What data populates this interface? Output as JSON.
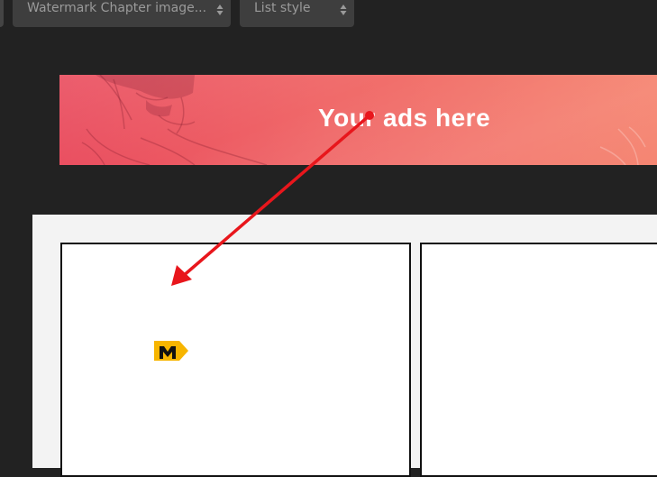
{
  "toolbar": {
    "watermark_select": {
      "value": "Watermark Chapter image..."
    },
    "list_style_select": {
      "value": "List style"
    }
  },
  "banner": {
    "text": "Your ads here"
  },
  "logo": {
    "letter": "M"
  },
  "colors": {
    "background": "#222222",
    "select_bg": "#3e3e3e",
    "banner_start": "#e94a5c",
    "banner_end": "#f5836f",
    "annotation_arrow": "#e8161c",
    "logo_yellow": "#f7b500"
  }
}
